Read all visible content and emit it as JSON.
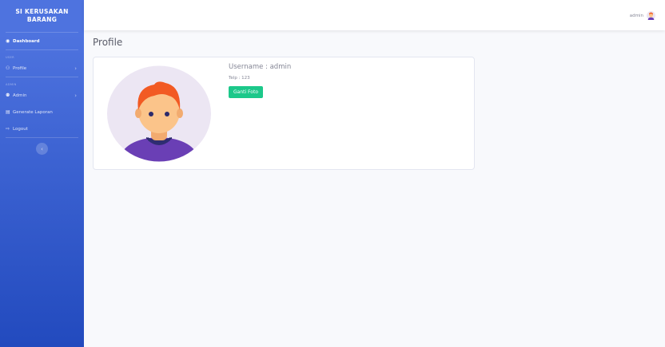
{
  "sidebar": {
    "brand_line1": "SI KERUSAKAN",
    "brand_line2": "BARANG",
    "dashboard_label": "Dashboard",
    "heading_user": "USER",
    "profile_label": "Profile",
    "heading_admin": "ADMIN",
    "admin_label": "Admin",
    "generate_label": "Generate Laporan",
    "logout_label": "Logout",
    "toggle_glyph": "‹"
  },
  "topbar": {
    "username": "admin"
  },
  "page": {
    "title": "Profile"
  },
  "profile": {
    "username_text": "Username : admin",
    "telp_text": "Telp : 123",
    "change_photo_label": "Ganti Foto"
  },
  "colors": {
    "sidebar_top": "#4e73df",
    "sidebar_bottom": "#224abe",
    "success": "#1cc88a",
    "page_bg": "#f8f9fc"
  },
  "icons": {
    "dashboard": "tachometer-icon",
    "profile": "user-icon",
    "admin": "users-icon",
    "generate": "file-icon",
    "logout": "logout-icon"
  }
}
